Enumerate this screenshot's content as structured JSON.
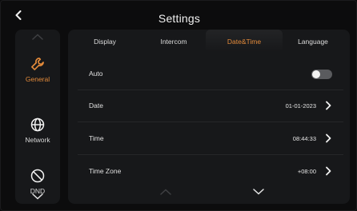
{
  "header": {
    "title": "Settings",
    "back_icon": "chevron-left-icon"
  },
  "sidebar": {
    "items": [
      {
        "label": "General",
        "icon": "wrench-icon",
        "active": true
      },
      {
        "label": "Network",
        "icon": "globe-icon",
        "active": false
      },
      {
        "label": "DND",
        "icon": "do-not-disturb-icon",
        "active": false
      }
    ]
  },
  "tabs": [
    {
      "label": "Display",
      "active": false
    },
    {
      "label": "Intercom",
      "active": false
    },
    {
      "label": "Date&Time",
      "active": true
    },
    {
      "label": "Language",
      "active": false
    }
  ],
  "rows": [
    {
      "label": "Auto",
      "control": "toggle",
      "toggle_on": false
    },
    {
      "label": "Date",
      "value": "01-01-2023"
    },
    {
      "label": "Time",
      "value": "08:44:33"
    },
    {
      "label": "Time Zone",
      "value": "+08:00"
    }
  ],
  "colors": {
    "accent": "#e38a3a",
    "background": "#0c0c0d",
    "panel": "#17181a",
    "toggle_off": "#5a5b5e"
  }
}
